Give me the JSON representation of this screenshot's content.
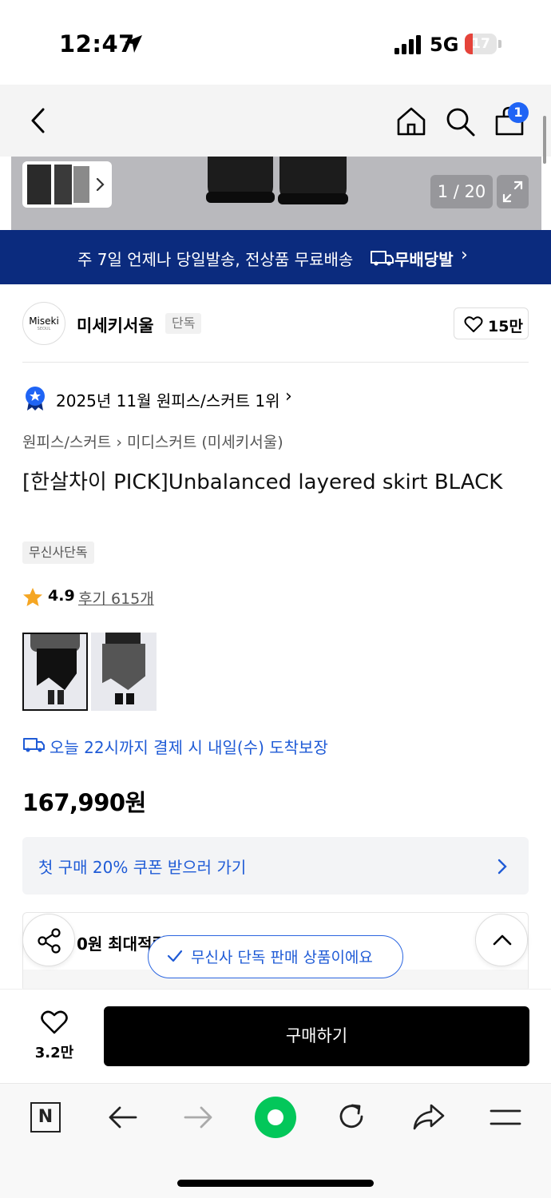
{
  "status": {
    "time": "12:47",
    "network": "5G",
    "battery": "17"
  },
  "header": {
    "cart_count": "1"
  },
  "gallery": {
    "counter": "1 / 20"
  },
  "banner": {
    "text": "주 7일 언제나 당일발송, 전상품 무료배송",
    "brand": "무배당발",
    "chevron": "›"
  },
  "brand": {
    "logo_text": "Miseki",
    "logo_sub": "SEOUL",
    "name": "미세키서울",
    "tag": "단독",
    "likes": "15만"
  },
  "ranking": {
    "text": "2025년 11월 원피스/스커트 1위",
    "chevron": "›"
  },
  "breadcrumb": "원피스/스커트 › 미디스커트 (미세키서울)",
  "product": {
    "title": "[한살차이 PICK]Unbalanced layered skirt BLACK",
    "tag": "무신사단독",
    "rating": "4.9",
    "reviews": "후기 615개",
    "delivery": "오늘 22시까지 결제 시 내일(수) 도착보장",
    "price": "167,990원"
  },
  "coupon": {
    "text": "첫 구매 20% 쿠폰 받으러 가기"
  },
  "reward": {
    "text": "0원 최대적립"
  },
  "toast": {
    "text": "무신사 단독 판매 상품이에요"
  },
  "purchase": {
    "wish_count": "3.2만",
    "buy_label": "구매하기"
  },
  "browser": {
    "n_label": "N"
  },
  "colors": {
    "brand_blue": "#0b2b7e",
    "accent_blue": "#1f5bd6",
    "star": "#f5a623",
    "battery_red": "#e5433a"
  }
}
